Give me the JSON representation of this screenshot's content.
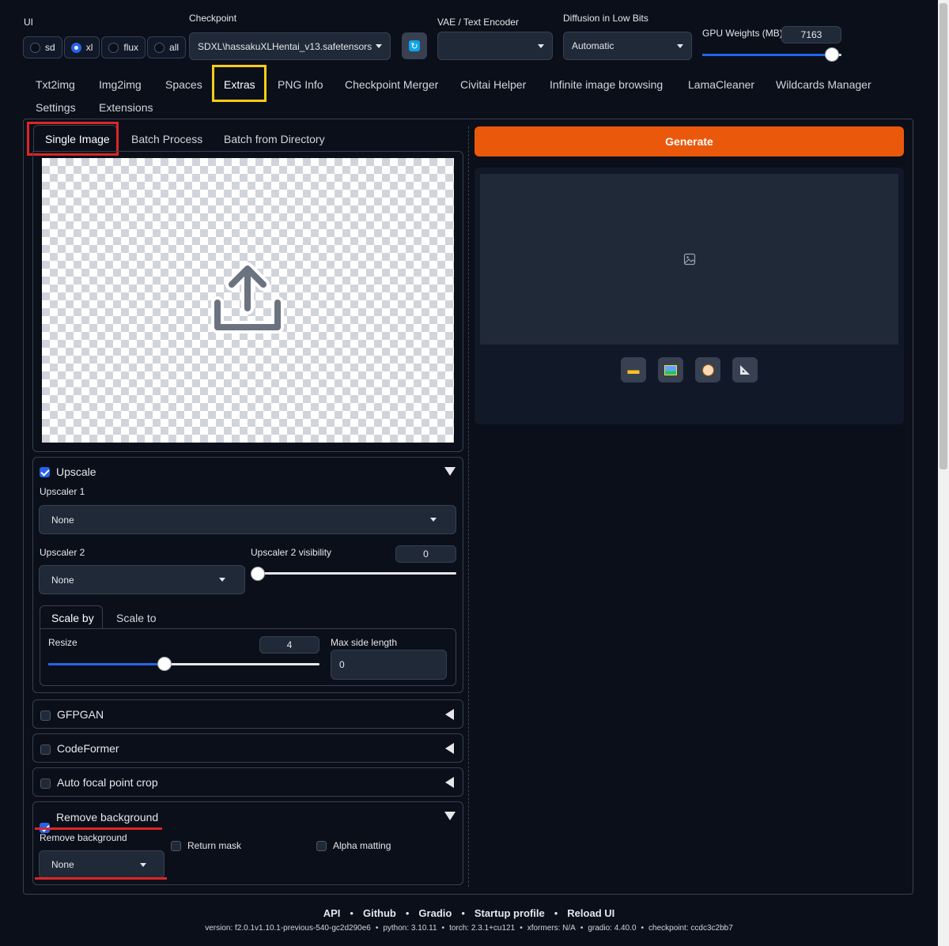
{
  "top": {
    "ui_label": "UI",
    "ui_options": [
      "sd",
      "xl",
      "flux",
      "all"
    ],
    "ui_selected": "xl",
    "checkpoint_label": "Checkpoint",
    "checkpoint_value": "SDXL\\hassakuXLHentai_v13.safetensors",
    "vae_label": "VAE / Text Encoder",
    "vae_value": "",
    "diffusion_label": "Diffusion in Low Bits",
    "diffusion_value": "Automatic",
    "gpu_label": "GPU Weights (MB)",
    "gpu_value": "7163",
    "gpu_fraction": 0.93
  },
  "main_tabs": [
    "Txt2img",
    "Img2img",
    "Spaces",
    "Extras",
    "PNG Info",
    "Checkpoint Merger",
    "Civitai Helper",
    "Infinite image browsing",
    "LamaCleaner",
    "Wildcards Manager",
    "Settings",
    "Extensions"
  ],
  "main_tab_active": "Extras",
  "sub_tabs": [
    "Single Image",
    "Batch Process",
    "Batch from Directory"
  ],
  "sub_tab_active": "Single Image",
  "generate_label": "Generate",
  "upscale": {
    "title": "Upscale",
    "checked": true,
    "upscaler1_label": "Upscaler 1",
    "upscaler1_value": "None",
    "upscaler2_label": "Upscaler 2",
    "upscaler2_value": "None",
    "upscaler2_vis_label": "Upscaler 2 visibility",
    "upscaler2_vis_value": "0",
    "scale_tabs": [
      "Scale by",
      "Scale to"
    ],
    "resize_label": "Resize",
    "resize_value": "4",
    "resize_fraction": 0.43,
    "max_side_label": "Max side length",
    "max_side_value": "0"
  },
  "sections": [
    {
      "title": "GFPGAN",
      "checked": false
    },
    {
      "title": "CodeFormer",
      "checked": false
    },
    {
      "title": "Auto focal point crop",
      "checked": false
    }
  ],
  "remove_bg": {
    "title": "Remove background",
    "checked": true,
    "dropdown_label": "Remove background",
    "dropdown_value": "None",
    "return_mask": "Return mask",
    "alpha_matting": "Alpha matting"
  },
  "output_tools": [
    "folder-icon",
    "image-icon",
    "palette-icon",
    "ruler-icon"
  ],
  "footer": {
    "links": [
      "API",
      "Github",
      "Gradio",
      "Startup profile",
      "Reload UI"
    ],
    "version": "version: f2.0.1v1.10.1-previous-540-gc2d290e6",
    "python": "python: 3.10.11",
    "torch": "torch: 2.3.1+cu121",
    "xformers": "xformers: N/A",
    "gradio": "gradio: 4.40.0",
    "checkpoint": "checkpoint: ccdc3c2bb7"
  },
  "colors": {
    "accent": "#2563eb",
    "generate": "#f97316",
    "highlight_red": "#dc2626",
    "highlight_yellow": "#facc15"
  }
}
